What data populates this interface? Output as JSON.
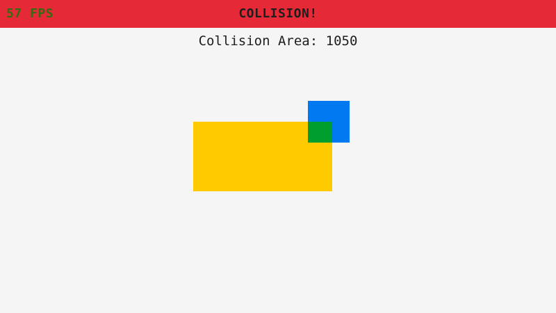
{
  "hud": {
    "fps_text": "57 FPS",
    "banner_text": "COLLISION!",
    "area_label": "Collision Area: ",
    "area_value": "1050"
  },
  "colors": {
    "background": "#f5f5f5",
    "banner": "#e62937",
    "fps_text": "#356b12",
    "text": "#1e1e1e",
    "gold_box": "#ffcb00",
    "blue_box": "#0079f1",
    "overlap_box": "#009e2f"
  }
}
